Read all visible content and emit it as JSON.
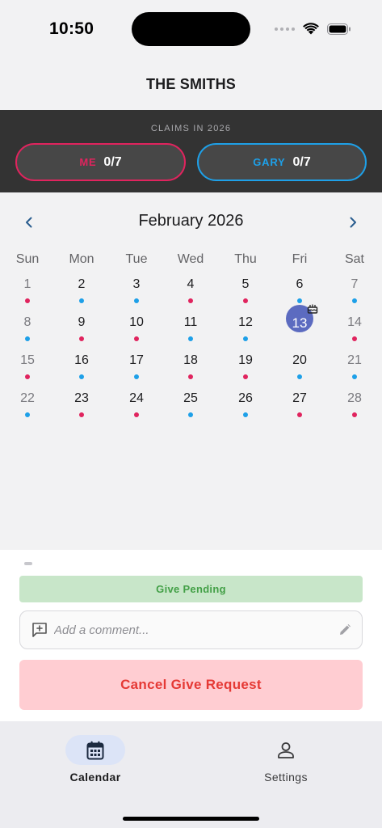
{
  "status_bar": {
    "time": "10:50"
  },
  "header": {
    "title": "THE SMITHS"
  },
  "claims": {
    "label": "CLAIMS IN 2026",
    "me": {
      "name": "ME",
      "count": "0/7",
      "color": "#e0245e"
    },
    "gary": {
      "name": "GARY",
      "count": "0/7",
      "color": "#1ea0e8"
    }
  },
  "calendar": {
    "month_title": "February 2026",
    "prev_icon": "chevron-left-icon",
    "next_icon": "chevron-right-icon",
    "weekdays": [
      "Sun",
      "Mon",
      "Tue",
      "Wed",
      "Thu",
      "Fri",
      "Sat"
    ],
    "today": 13,
    "birthday_day": 13,
    "weeks": [
      [
        {
          "d": "1",
          "c": "red"
        },
        {
          "d": "2",
          "c": "blue"
        },
        {
          "d": "3",
          "c": "blue"
        },
        {
          "d": "4",
          "c": "red"
        },
        {
          "d": "5",
          "c": "red"
        },
        {
          "d": "6",
          "c": "blue"
        },
        {
          "d": "7",
          "c": "blue"
        }
      ],
      [
        {
          "d": "8",
          "c": "blue"
        },
        {
          "d": "9",
          "c": "red"
        },
        {
          "d": "10",
          "c": "red"
        },
        {
          "d": "11",
          "c": "blue"
        },
        {
          "d": "12",
          "c": "blue"
        },
        {
          "d": "13",
          "c": ""
        },
        {
          "d": "14",
          "c": "red"
        }
      ],
      [
        {
          "d": "15",
          "c": "red"
        },
        {
          "d": "16",
          "c": "blue"
        },
        {
          "d": "17",
          "c": "blue"
        },
        {
          "d": "18",
          "c": "red"
        },
        {
          "d": "19",
          "c": "red"
        },
        {
          "d": "20",
          "c": "blue"
        },
        {
          "d": "21",
          "c": "blue"
        }
      ],
      [
        {
          "d": "22",
          "c": "blue"
        },
        {
          "d": "23",
          "c": "red"
        },
        {
          "d": "24",
          "c": "red"
        },
        {
          "d": "25",
          "c": "blue"
        },
        {
          "d": "26",
          "c": "blue"
        },
        {
          "d": "27",
          "c": "red"
        },
        {
          "d": "28",
          "c": "red"
        }
      ]
    ]
  },
  "sheet": {
    "status_badge": "Give Pending",
    "comment_placeholder": "Add a comment...",
    "cancel_label": "Cancel Give Request"
  },
  "tabs": [
    {
      "label": "Calendar",
      "icon": "calendar-icon",
      "active": true
    },
    {
      "label": "Settings",
      "icon": "person-icon",
      "active": false
    }
  ],
  "colors": {
    "accent_me": "#e0245e",
    "accent_gary": "#1ea0e8",
    "today": "#5c6bc0",
    "pending_bg": "#c8e6c9",
    "pending_text": "#43a047",
    "cancel_bg": "#ffcdd2",
    "cancel_text": "#e53935"
  }
}
